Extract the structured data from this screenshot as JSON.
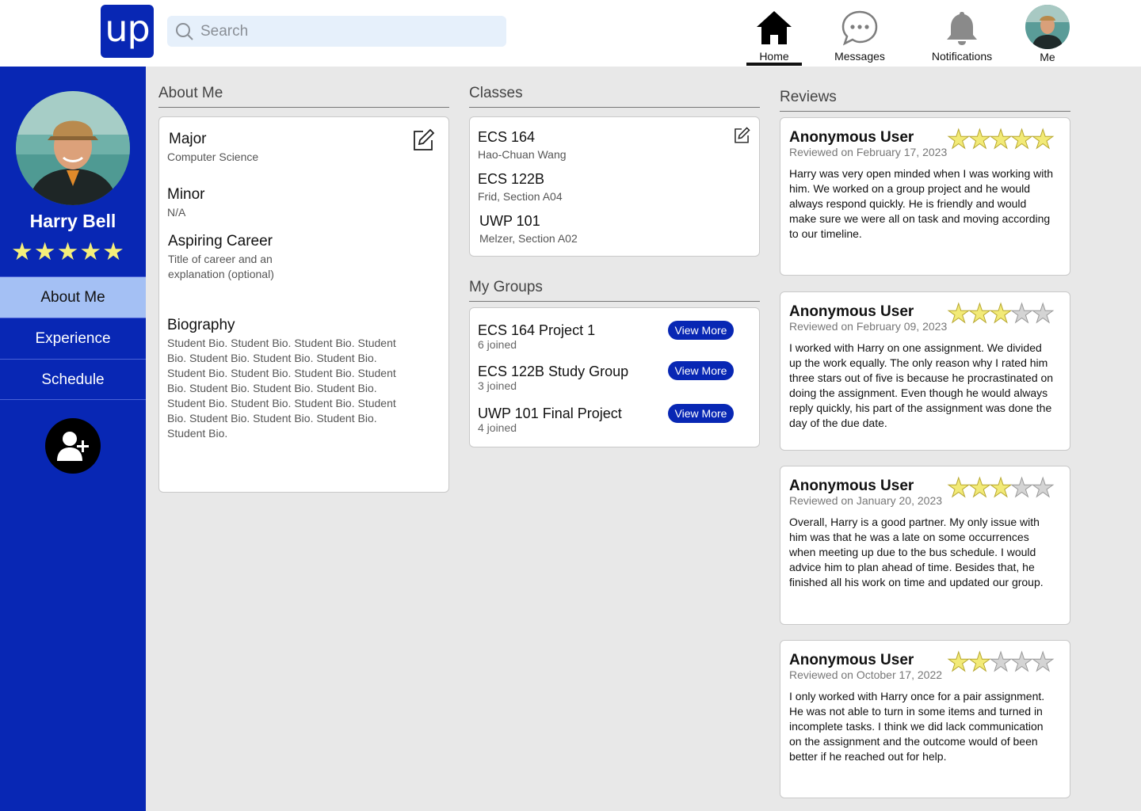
{
  "header": {
    "logo_text": "up",
    "search_placeholder": "Search",
    "nav": {
      "home": "Home",
      "messages": "Messages",
      "notifications": "Notifications",
      "me": "Me"
    }
  },
  "sidebar": {
    "name": "Harry Bell",
    "rating_stars": 5,
    "stars_text": "★★★★★",
    "tabs": [
      "About Me",
      "Experience",
      "Schedule"
    ],
    "active_tab": "About Me"
  },
  "about": {
    "section_title": "About Me",
    "major_label": "Major",
    "major_value": "Computer Science",
    "minor_label": "Minor",
    "minor_value": "N/A",
    "career_label": "Aspiring Career",
    "career_value": "Title of career and an explanation (optional)",
    "bio_label": "Biography",
    "bio_value": "Student Bio. Student Bio. Student Bio. Student Bio. Student Bio. Student Bio. Student Bio. Student Bio. Student Bio. Student Bio. Student Bio. Student Bio. Student Bio. Student Bio. Student Bio. Student Bio. Student Bio. Student Bio. Student Bio. Student Bio. Student Bio. Student Bio."
  },
  "classes": {
    "section_title": "Classes",
    "items": [
      {
        "code": "ECS 164",
        "detail": "Hao-Chuan Wang"
      },
      {
        "code": "ECS 122B",
        "detail": "Frid, Section A04"
      },
      {
        "code": "UWP 101",
        "detail": "Melzer, Section A02"
      }
    ]
  },
  "groups": {
    "section_title": "My Groups",
    "button_label": "View More",
    "items": [
      {
        "name": "ECS 164 Project 1",
        "joined": "6 joined"
      },
      {
        "name": "ECS 122B Study Group",
        "joined": "3 joined"
      },
      {
        "name": "UWP 101 Final Project",
        "joined": "4 joined"
      }
    ]
  },
  "reviews": {
    "section_title": "Reviews",
    "items": [
      {
        "user": "Anonymous User",
        "date": "Reviewed on February 17, 2023",
        "rating": 5,
        "text": "Harry was very open minded when I was working with him. We worked on a group project and he would always respond quickly. He is friendly and would make sure we were all on task and moving according to our timeline."
      },
      {
        "user": "Anonymous User",
        "date": "Reviewed on February 09, 2023",
        "rating": 3,
        "text": "I worked with Harry on one assignment. We divided up the work equally. The only reason why I rated him three stars out of five is because he procrastinated on doing the assignment. Even though he would always reply quickly, his part of the assignment was done the day of the due date."
      },
      {
        "user": "Anonymous User",
        "date": "Reviewed on January 20, 2023",
        "rating": 3,
        "text": "Overall, Harry is a good partner. My only issue with him was that he was a late on some occurrences when meeting up due to the bus schedule. I would advice him to plan ahead of time. Besides that, he finished all his work on time and updated our group."
      },
      {
        "user": "Anonymous User",
        "date": "Reviewed on October 17, 2022",
        "rating": 2,
        "text": "I only worked with Harry once for a pair assignment. He was not able to turn in some items and turned in incomplete tasks. I think we did lack communication on the assignment and the outcome would of been better if he reached out for help."
      }
    ]
  },
  "colors": {
    "brand": "#0827b4",
    "active_tab": "#a4c0f4",
    "star": "#f2ea77",
    "background": "#e8e8e8"
  },
  "icons": [
    "search-icon",
    "home-icon",
    "messages-icon",
    "notifications-icon",
    "edit-icon",
    "add-friend-icon",
    "star-icon"
  ]
}
